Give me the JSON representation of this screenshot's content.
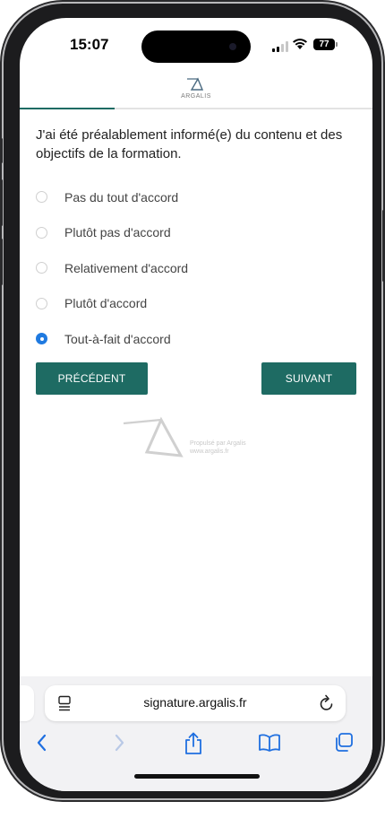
{
  "status_bar": {
    "time": "15:07",
    "battery": "77",
    "icons": [
      "cellular-signal-icon",
      "wifi-icon",
      "battery-icon"
    ]
  },
  "site": {
    "logo_text": "ARGALIS",
    "progress_fraction": 0.27
  },
  "survey": {
    "question": "J'ai été préalablement informé(e) du contenu et des objectifs de la formation.",
    "options": [
      {
        "label": "Pas du tout d'accord",
        "selected": false
      },
      {
        "label": "Plutôt pas d'accord",
        "selected": false
      },
      {
        "label": "Relativement d'accord",
        "selected": false
      },
      {
        "label": "Plutôt d'accord",
        "selected": false
      },
      {
        "label": "Tout-à-fait d'accord",
        "selected": true
      }
    ],
    "prev_label": "PRÉCÉDENT",
    "next_label": "SUIVANT"
  },
  "footer": {
    "powered_line1": "Propulsé par Argalis",
    "powered_line2": "www.argalis.fr"
  },
  "browser": {
    "url": "signature.argalis.fr",
    "toolbar_icons": [
      "back-icon",
      "forward-icon",
      "share-icon",
      "bookmarks-icon",
      "tabs-icon"
    ]
  },
  "colors": {
    "accent": "#1e6b63",
    "radio_selected": "#1f7ae0"
  }
}
